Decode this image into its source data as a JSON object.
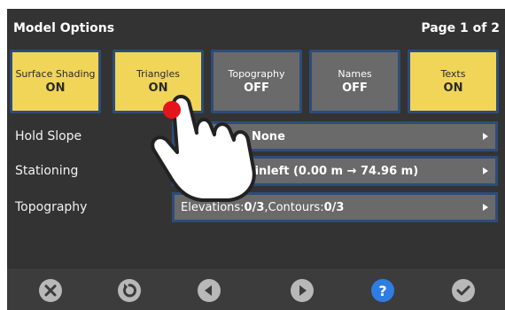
{
  "header": {
    "title": "Model Options",
    "page": "Page 1 of 2"
  },
  "toggles": [
    {
      "label": "Surface Shading",
      "state": "ON"
    },
    {
      "label": "Triangles",
      "state": "ON"
    },
    {
      "label": "Topography",
      "state": "OFF"
    },
    {
      "label": "Names",
      "state": "OFF"
    },
    {
      "label": "Texts",
      "state": "ON"
    }
  ],
  "settings": {
    "hold_slope": {
      "label": "Hold Slope",
      "value": "None"
    },
    "stationing": {
      "label": "Stationing",
      "value": "rrainleft (0.00 m → 74.96 m)"
    },
    "topography": {
      "label": "Topography",
      "elevations_label": "Elevations: ",
      "elevations_value": "0/3",
      "separator": ", ",
      "contours_label": "Contours: ",
      "contours_value": "0/3"
    }
  },
  "footer": {
    "buttons": [
      "close-icon",
      "reset-icon",
      "previous-icon",
      "next-icon",
      "help-icon",
      "confirm-icon"
    ],
    "help_glyph": "?"
  },
  "colors": {
    "on": "#f1d558",
    "off": "#6a6a6a",
    "border": "#2e4c7a",
    "help": "#2f7de2",
    "background": "#333333"
  }
}
